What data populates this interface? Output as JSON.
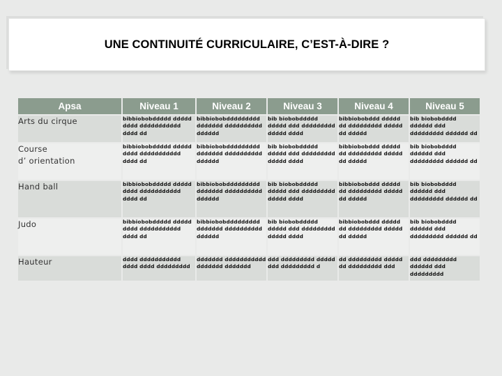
{
  "slide": {
    "title": "UNE CONTINUITÉ  CURRICULAIRE, C’EST-À-DIRE  ?",
    "background_color": "#e9eae9",
    "title_box_color": "#ffffff"
  },
  "table": {
    "header_bg": "#8b9c8e",
    "header_text_color": "#ffffff",
    "row_shade_dark": "#d9dcd9",
    "row_shade_light": "#eeefee",
    "columns": [
      "Apsa",
      "Niveau 1",
      "Niveau 2",
      "Niveau 3",
      "Niveau 4",
      "Niveau 5"
    ],
    "rows": [
      {
        "apsa": "Arts du cirque",
        "niveau1": "bibbiobobddddd ddddd dddd ddddddddddd dddd dd",
        "niveau2": "bibbiobobddddddddd ddddddd dddddddddd dddddd",
        "niveau3": "bib biobobddddd ddddd ddd ddddddddd ddddd dddd",
        "niveau4": "bibbiobobddd ddddd dd ddddddddd ddddd dd ddddd",
        "niveau5": "bib biobobdddd dddddd ddd ddddddddd dddddd dd"
      },
      {
        "apsa": "Course\nd’  orientation",
        "niveau1": "bibbiobobddddd ddddd dddd ddddddddddd dddd dd",
        "niveau2": "bibbiobobddddddddd ddddddd dddddddddd dddddd",
        "niveau3": "bib biobobddddd ddddd ddd ddddddddd ddddd dddd",
        "niveau4": "bibbiobobddd ddddd dd ddddddddd ddddd dd ddddd",
        "niveau5": "bib biobobdddd dddddd ddd ddddddddd dddddd dd"
      },
      {
        "apsa": "Hand ball",
        "niveau1": "bibbiobobddddd ddddd dddd ddddddddddd dddd dd",
        "niveau2": "bibbiobobddddddddd ddddddd dddddddddd dddddd",
        "niveau3": "bib biobobddddd ddddd ddd ddddddddd ddddd dddd",
        "niveau4": "bibbiobobddd ddddd dd ddddddddd ddddd dd ddddd",
        "niveau5": "bib biobobdddd dddddd ddd ddddddddd dddddd dd"
      },
      {
        "apsa": "Judo",
        "niveau1": "bibbiobobddddd ddddd dddd ddddddddddd dddd dd",
        "niveau2": "bibbiobobddddddddd ddddddd dddddddddd dddddd",
        "niveau3": "bib biobobddddd ddddd ddd ddddddddd ddddd dddd",
        "niveau4": "bibbiobobddd ddddd dd ddddddddd ddddd dd ddddd",
        "niveau5": "bib biobobdddd dddddd ddd ddddddddd dddddd dd"
      },
      {
        "apsa": "Hauteur",
        "niveau1": "dddd ddddddddddd dddd dddd ddddddddd",
        "niveau2": "ddddddd ddddddddddd ddddddd ddddddd",
        "niveau3": "ddd ddddddddd ddddd ddd ddddddddd d",
        "niveau4": "dd ddddddddd ddddd dd ddddddddd ddd",
        "niveau5": "ddd ddddddddd dddddd ddd ddddddddd"
      }
    ]
  }
}
